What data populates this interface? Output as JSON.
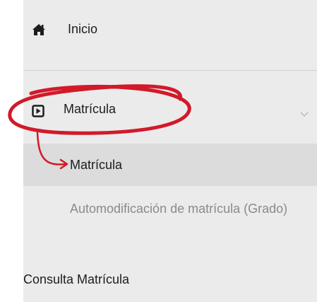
{
  "menu": {
    "inicio": {
      "label": "Inicio",
      "icon": "home-icon"
    },
    "matricula": {
      "label": "Matrícula",
      "icon": "play-square-icon",
      "chevron": "chevron-down-icon"
    },
    "submenu": [
      {
        "label": "Matrícula",
        "active": true
      },
      {
        "label": "Automodificación de matrícula (Grado)",
        "active": false
      }
    ],
    "consulta": {
      "label": "Consulta Matrícula"
    }
  },
  "annotation": {
    "color": "#d11a2a",
    "shapes": [
      "circle-annotation",
      "arrow-annotation"
    ]
  }
}
